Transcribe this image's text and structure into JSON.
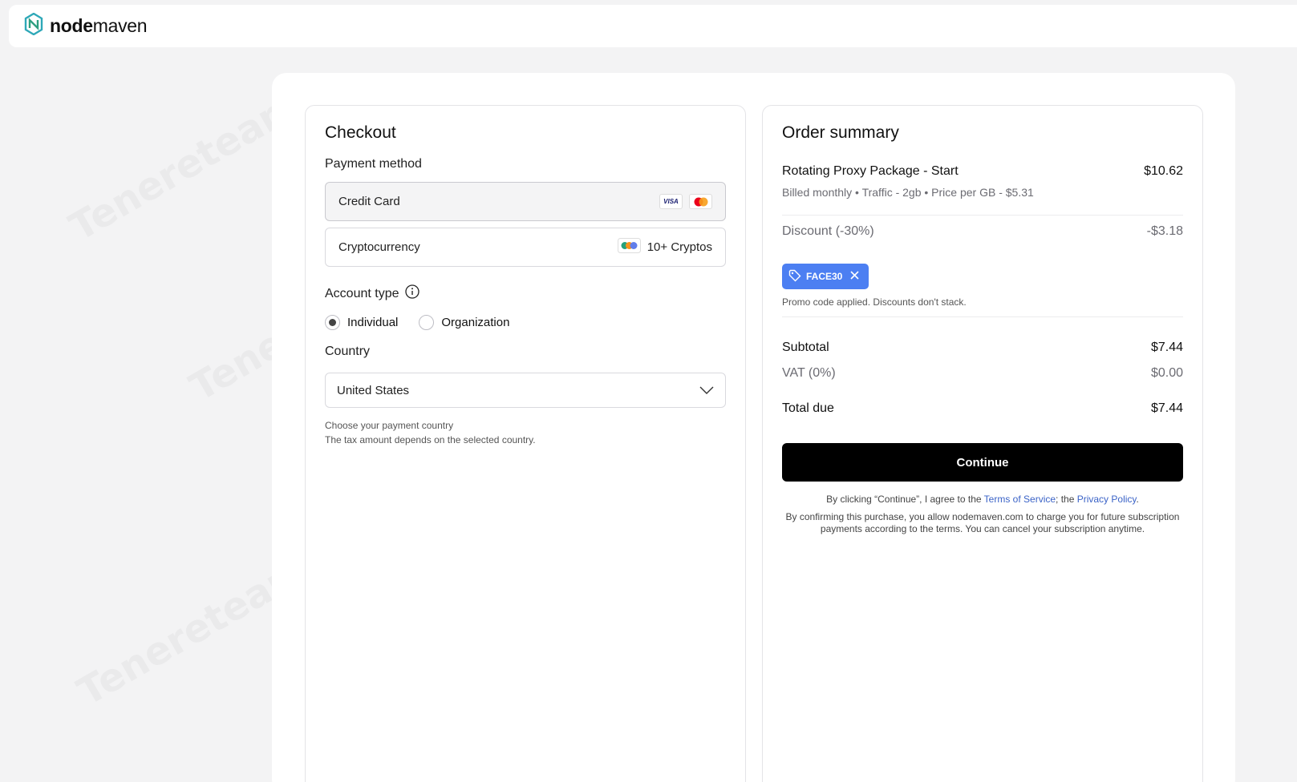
{
  "brand": {
    "bold": "node",
    "regular": "maven"
  },
  "checkout": {
    "title": "Checkout",
    "payment_method_label": "Payment method",
    "options": [
      {
        "label": "Credit Card",
        "badges": [
          "VISA",
          "mastercard"
        ]
      },
      {
        "label": "Cryptocurrency",
        "extra": "10+ Cryptos"
      }
    ],
    "account_type_label": "Account type",
    "account_types": [
      "Individual",
      "Organization"
    ],
    "selected_account_type": "Individual",
    "country_label": "Country",
    "country_value": "United States",
    "hint_1": "Choose your payment country",
    "hint_2": "The tax amount depends on the selected country."
  },
  "summary": {
    "title": "Order summary",
    "product_name": "Rotating Proxy Package - Start",
    "product_price": "$10.62",
    "product_details": "Billed monthly • Traffic - 2gb • Price per GB - $5.31",
    "discount_label": "Discount (-30%)",
    "discount_value": "-$3.18",
    "promo_code": "FACE30",
    "promo_note": "Promo code applied. Discounts don't stack.",
    "subtotal_label": "Subtotal",
    "subtotal_value": "$7.44",
    "vat_label": "VAT (0%)",
    "vat_value": "$0.00",
    "total_label": "Total due",
    "total_value": "$7.44",
    "continue_label": "Continue",
    "legal_1_pre": "By clicking “Continue”, I agree to the ",
    "terms_link": "Terms of Service",
    "legal_1_mid": "; the ",
    "privacy_link": "Privacy Policy",
    "legal_1_post": ".",
    "legal_2": "By confirming this purchase, you allow nodemaven.com to charge you for future subscription payments according to the terms. You can cancel your subscription anytime."
  },
  "watermark_text": "Tenereteam",
  "colors": {
    "accent": "#4c7ff2",
    "button": "#000000",
    "link": "#3b63c7"
  }
}
